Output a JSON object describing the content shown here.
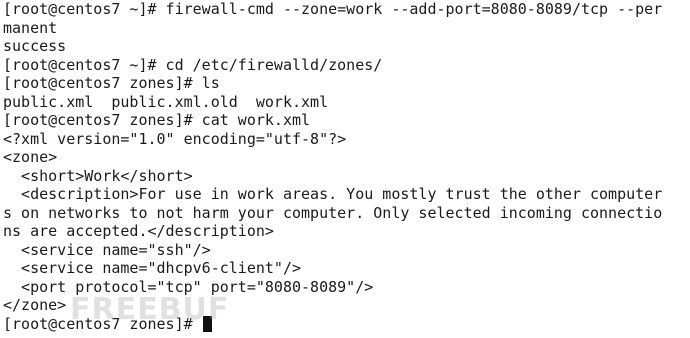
{
  "terminal": {
    "lines": [
      "[root@centos7 ~]# firewall-cmd --zone=work --add-port=8080-8089/tcp --per",
      "manent",
      "success",
      "[root@centos7 ~]# cd /etc/firewalld/zones/",
      "[root@centos7 zones]# ls",
      "public.xml  public.xml.old  work.xml",
      "[root@centos7 zones]# cat work.xml",
      "<?xml version=\"1.0\" encoding=\"utf-8\"?>",
      "<zone>",
      "  <short>Work</short>",
      "  <description>For use in work areas. You mostly trust the other computer",
      "s on networks to not harm your computer. Only selected incoming connectio",
      "ns are accepted.</description>",
      "  <service name=\"ssh\"/>",
      "  <service name=\"dhcpv6-client\"/>",
      "  <port protocol=\"tcp\" port=\"8080-8089\"/>",
      "</zone>"
    ],
    "prompt": "[root@centos7 zones]# "
  },
  "watermark": "FREEBUF"
}
